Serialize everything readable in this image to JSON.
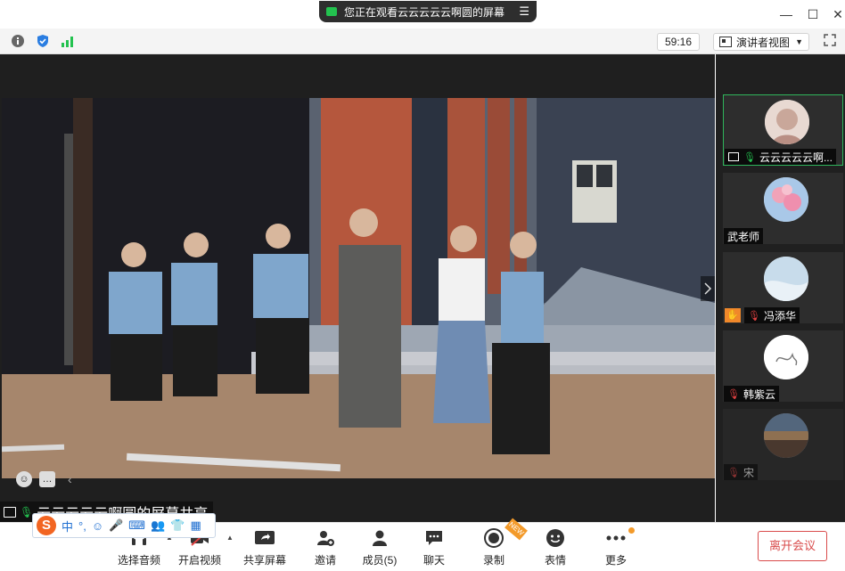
{
  "window": {
    "sharing_banner": "您正在观看云云云云云啊圆的屏幕",
    "controls": [
      "minimize-icon",
      "maximize-icon",
      "close-icon"
    ]
  },
  "infobar": {
    "timer": "59:16",
    "view_mode": "演讲者视图",
    "icons": [
      "info-icon",
      "shield-icon",
      "signal-icon",
      "fullscreen-icon"
    ]
  },
  "stage": {
    "screen_share_label": "云云云云云啊圆的屏幕共享",
    "accent": "#23c24f"
  },
  "participants": [
    {
      "name": "云云云云云啊...",
      "mic": "on",
      "sharing": true,
      "avatar": "anime-portrait"
    },
    {
      "name": "武老师",
      "mic": "none",
      "sharing": false,
      "avatar": "pink-flowers"
    },
    {
      "name": "冯添华",
      "mic": "muted",
      "sharing": false,
      "avatar": "light-blue-sky",
      "hand": true
    },
    {
      "name": "韩紫云",
      "mic": "muted",
      "sharing": false,
      "avatar": "sketch-drawing"
    },
    {
      "name": "宋",
      "mic": "muted-dim",
      "sharing": false,
      "avatar": "landscape-sunset"
    }
  ],
  "toolbar": {
    "audio_label": "选择音频",
    "video_label": "开启视频",
    "share_label": "共享屏幕",
    "invite_label": "邀请",
    "members_label": "成员(5)",
    "chat_label": "聊天",
    "record_label": "录制",
    "reactions_label": "表情",
    "more_label": "更多",
    "leave_label": "离开会议",
    "record_badge": "NEW",
    "leave_color": "#d94b4b"
  },
  "ime": {
    "logo": "S",
    "items": [
      "中",
      "°,",
      "☺",
      "🎤",
      "⌨",
      "👥",
      "👕",
      "▦"
    ]
  }
}
